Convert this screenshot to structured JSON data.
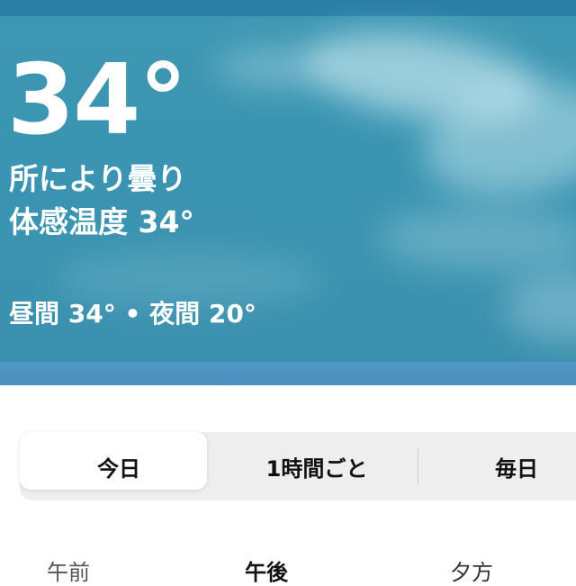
{
  "hero": {
    "temperature": "34°",
    "condition": "所により曇り",
    "feels_like": "体感温度 34°",
    "high_low": "昼間 34° • 夜間 20°"
  },
  "tabs": {
    "today": "今日",
    "hourly": "1時間ごと",
    "daily": "毎日",
    "selected": "今日"
  },
  "periods": [
    "午前",
    "午後",
    "夕方"
  ],
  "colors": {
    "sky": "#3b93b0",
    "text": "#ffffff",
    "segment_bg": "#eeeeef"
  }
}
